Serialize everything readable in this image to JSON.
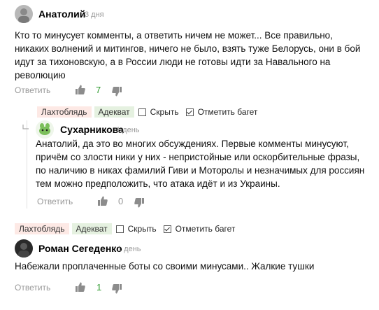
{
  "comments": [
    {
      "author": "Анатолий",
      "time": "3 дня",
      "text_lines": [
        "Кто то минусует комменты, а ответить ничем не может... Все правильно,",
        "никаких волнений и митингов, ничего не было, взять туже Белорусь, они в бой",
        "идут за тихоновскую, а в России люди не готовы идти за Навального на",
        "революцию"
      ],
      "reply_label": "Ответить",
      "likes": "7"
    },
    {
      "author": "Сухарникова",
      "time": "1 день",
      "text_lines": [
        "Анатолий, да это во многих обсуждениях. Первые комменты минусуют,",
        "причём со злости ники у них - непристойные или оскорбительные фразы,",
        "по наличию в никах фамилий Гиви и Моторолы и незначимых для россиян",
        "тем можно предположить, что атака идёт и из Украины."
      ],
      "reply_label": "Ответить",
      "likes": "0"
    },
    {
      "author": "Роман Сегеденко",
      "time": "1 день",
      "text_lines": [
        "Набежали проплаченные боты со своими минусами.. Жалкие тушки"
      ],
      "reply_label": "Ответить",
      "likes": "1"
    }
  ],
  "tagbar": {
    "tag_red": "Лахтоблядь",
    "tag_green": "Адекват",
    "hide_label": "Скрыть",
    "hide_checked": false,
    "bug_label": "Отметить багет",
    "bug_checked": true
  },
  "icons": [
    "avatar",
    "thumb-up-icon",
    "thumb-down-icon",
    "reply-arrow-icon",
    "checkbox-icon"
  ],
  "colors": {
    "like_green": "#2e9a2e",
    "tag_red_bg": "#fde9e5",
    "tag_green_bg": "#e5f1e0",
    "muted": "#999999"
  }
}
